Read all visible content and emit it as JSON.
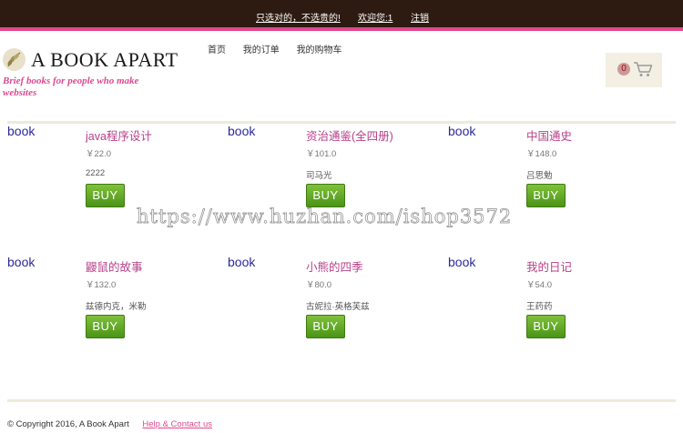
{
  "topbar": {
    "slogan": "只选对的，不选贵的!",
    "welcome": "欢迎您:1",
    "logout": "注销"
  },
  "brand": {
    "title": "A BOOK APART",
    "tagline": "Brief books for people who make websites",
    "accent_color": "#e0488f"
  },
  "nav": {
    "home": "首页",
    "orders": "我的订单",
    "cart": "我的购物车"
  },
  "cart": {
    "count": "0",
    "icon": "shopping-cart-icon"
  },
  "products": [
    {
      "image_alt": "book",
      "title": "java程序设计",
      "price": "￥22.0",
      "author": "2222",
      "buy_label": "BUY"
    },
    {
      "image_alt": "book",
      "title": "资治通鉴(全四册)",
      "price": "￥101.0",
      "author": "司马光",
      "buy_label": "BUY"
    },
    {
      "image_alt": "book",
      "title": "中国通史",
      "price": "￥148.0",
      "author": "吕思勉",
      "buy_label": "BUY"
    },
    {
      "image_alt": "book",
      "title": "鼹鼠的故事",
      "price": "￥132.0",
      "author": "兹德内克，米勒",
      "buy_label": "BUY"
    },
    {
      "image_alt": "book",
      "title": "小熊的四季",
      "price": "￥80.0",
      "author": "古妮拉·英格芙兹",
      "buy_label": "BUY"
    },
    {
      "image_alt": "book",
      "title": "我的日记",
      "price": "￥54.0",
      "author": "王药药",
      "buy_label": "BUY"
    }
  ],
  "watermark": "https://www.huzhan.com/ishop3572",
  "footer": {
    "copyright": "© Copyright 2016, A Book Apart",
    "help_link": "Help & Contact us"
  }
}
